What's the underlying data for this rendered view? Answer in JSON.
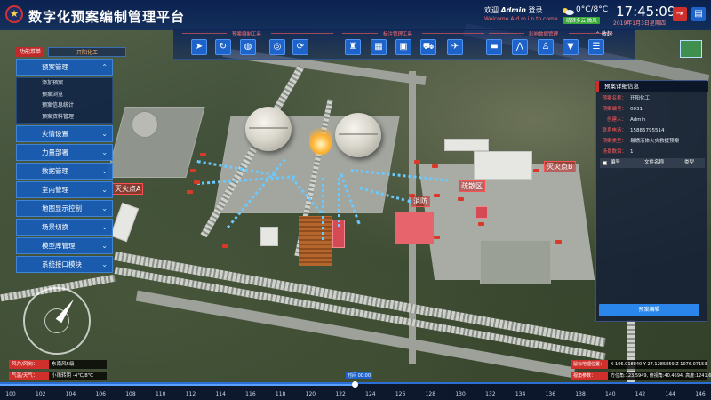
{
  "header": {
    "title": "数字化预案编制管理平台",
    "logo_glyph": "★",
    "welcome_prefix": "欢迎",
    "user": "Admin",
    "login": "登录",
    "welcome_en": "Welcome  A d m i n  to come",
    "temperature": "0°C/8°C",
    "weather_badge": "晴转多云 微风",
    "time": "17:45:09",
    "date": "2019年1月3日星期四",
    "collapse": "收起"
  },
  "toolbar": {
    "groups": [
      {
        "label": "预案编制工具"
      },
      {
        "label": "标注管理工具"
      },
      {
        "label": "影响数据管理"
      }
    ]
  },
  "left_menu": {
    "tab_active": "功能菜单",
    "tab_other": "开阳化工",
    "items": [
      {
        "label": "预案管理",
        "expanded": true
      },
      {
        "label": "灾情设置"
      },
      {
        "label": "力量部署"
      },
      {
        "label": "数据管理"
      },
      {
        "label": "室内管理"
      },
      {
        "label": "地图显示控制"
      },
      {
        "label": "场景切换"
      },
      {
        "label": "模型库管理"
      },
      {
        "label": "系统接口模块"
      }
    ],
    "sub_items": [
      {
        "label": "添加预案"
      },
      {
        "label": "预案浏览"
      },
      {
        "label": "预案信息统计"
      },
      {
        "label": "预案资料管理"
      }
    ]
  },
  "map_labels": {
    "label_a": "灭火点A",
    "label_b": "疏散区",
    "label_c": "消防",
    "label_d": "灭火点B"
  },
  "status": {
    "wind_label": "风力/风向：",
    "wind_value": "东南风5级",
    "weather_label": "气温/天气：",
    "weather_value": "小雨转阴 -4℃/8℃"
  },
  "coords": {
    "position_label": "鼠标地理位置：",
    "position_value": "X 106.918840  Y 27.1285859  Z 1076.07153",
    "camera_label": "视角参数：",
    "camera_value": "方位角:123.5949, 俯视角:40.4694, 高度:1241.6"
  },
  "timeline": {
    "ticks": [
      "100",
      "102",
      "104",
      "106",
      "108",
      "110",
      "112",
      "114",
      "116",
      "118",
      "120",
      "122",
      "124",
      "126",
      "128",
      "130",
      "132",
      "134",
      "136",
      "138",
      "140",
      "142",
      "144",
      "146"
    ],
    "current_label": "时间 00:00",
    "progress": 0.5
  },
  "right_panel": {
    "title": "预案详细信息",
    "fields": [
      {
        "k": "预案名称：",
        "v": "开阳化工"
      },
      {
        "k": "预案编号：",
        "v": "0031"
      },
      {
        "k": "创建人：",
        "v": "Admin"
      },
      {
        "k": "联系电话：",
        "v": "15885795514"
      },
      {
        "k": "预案类型：",
        "v": "易燃液体火灾救援预案"
      },
      {
        "k": "场景数目：",
        "v": "1"
      }
    ],
    "table_headers": [
      "编号",
      "文件名称",
      "类型"
    ],
    "button": "预案编辑"
  },
  "colors": {
    "accent_blue": "#1e63c9",
    "accent_red": "#d0302c",
    "header_bg": "#0a2860"
  }
}
